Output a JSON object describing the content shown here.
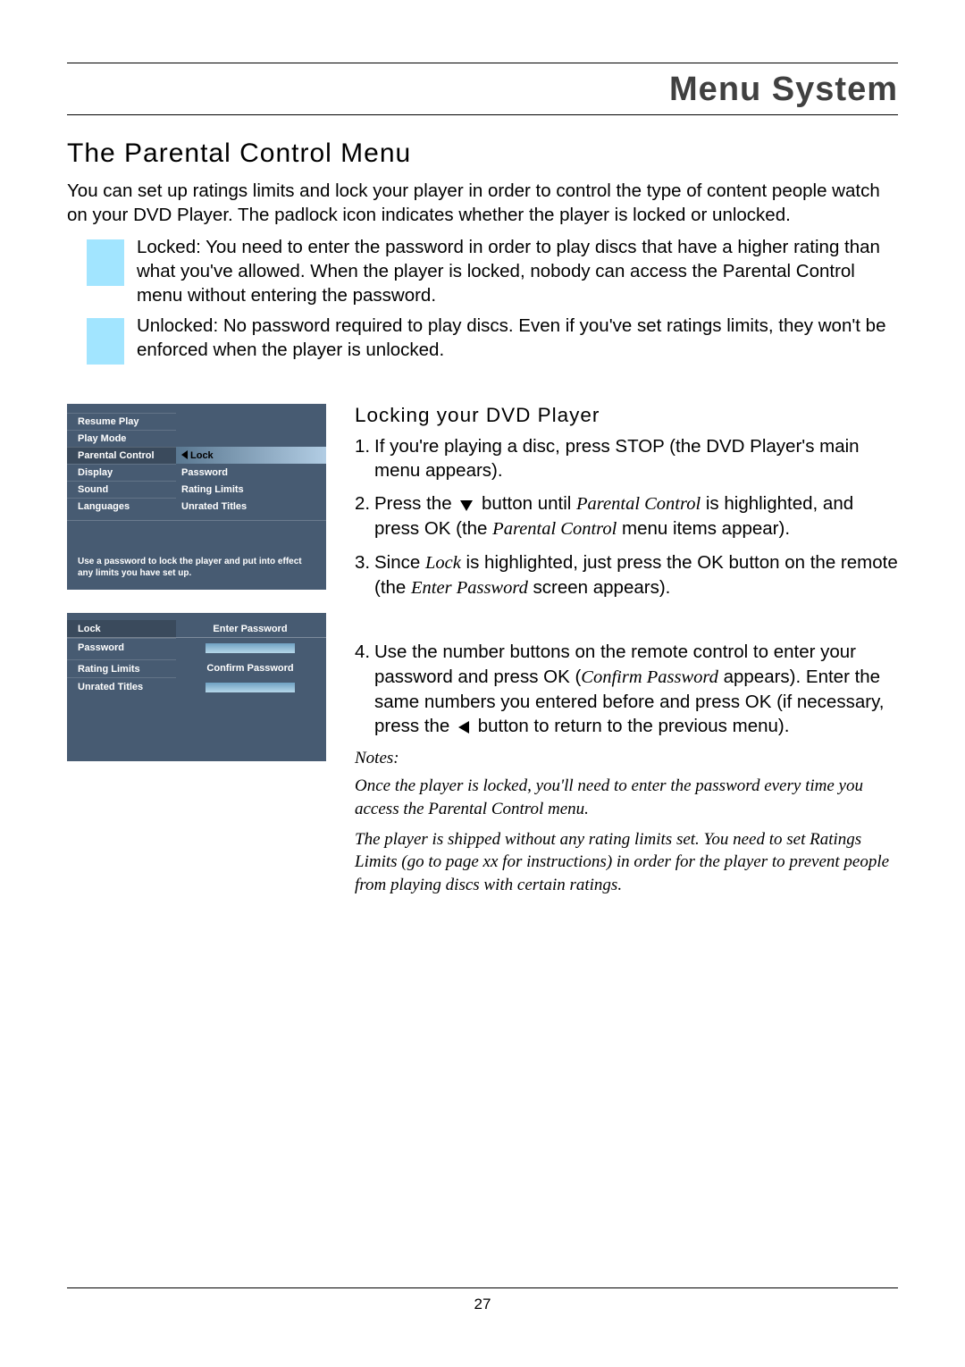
{
  "header": "Menu System",
  "section_title": "The Parental Control Menu",
  "intro": "You can set up ratings limits and lock your player in order to control the type of content people watch on your DVD Player. The padlock icon indicates whether the player is locked or unlocked.",
  "locked_text": "Locked: You need to enter the password in order to play discs that have a higher rating than what you've allowed. When the player is locked, nobody can access the Parental Control menu without entering the password.",
  "unlocked_text": "Unlocked: No password required to play discs. Even if you've set ratings limits, they won't be enforced when the player is unlocked.",
  "ui1": {
    "left_items": [
      "Resume Play",
      "Play Mode",
      "Parental Control",
      "Display",
      "Sound",
      "Languages"
    ],
    "selected_left_index": 2,
    "right_items": [
      "Lock",
      "Password",
      "Rating Limits",
      "Unrated Titles"
    ],
    "highlight_right_index": 0,
    "hint": "Use a password to lock the player and put into effect any limits you have set up."
  },
  "ui2": {
    "left_items": [
      "Lock",
      "Password",
      "Rating Limits",
      "Unrated Titles"
    ],
    "right_labels": [
      "Enter Password",
      "Confirm Password"
    ]
  },
  "sub_head": "Locking your DVD Player",
  "steps": {
    "s1": "If you're playing a disc, press STOP (the DVD Player's main menu appears).",
    "s2_a": "Press the",
    "s2_b": "button until",
    "s2_c": "Parental Control",
    "s2_d": "is highlighted, and press OK (the",
    "s2_e": "Parental Control",
    "s2_f": "menu items appear).",
    "s3_a": "Since",
    "s3_b": "Lock",
    "s3_c": "is highlighted, just press the OK button on the remote (the",
    "s3_d": "Enter Password",
    "s3_e": "screen appears).",
    "s4_a": "Use the number buttons on the remote control to enter your password and press OK (",
    "s4_b": "Confirm Password",
    "s4_c": "appears). Enter the same numbers you entered before and press OK (if necessary, press the",
    "s4_d": "button to return to the previous menu)."
  },
  "notes_head": "Notes:",
  "note1": "Once the player is locked, you'll need to enter the password every time you access the Parental Control menu.",
  "note2": "The player is shipped without any rating limits set. You need to set Ratings Limits (go to page xx for instructions) in order for the player to prevent people from playing discs with certain ratings.",
  "page_num": "27"
}
